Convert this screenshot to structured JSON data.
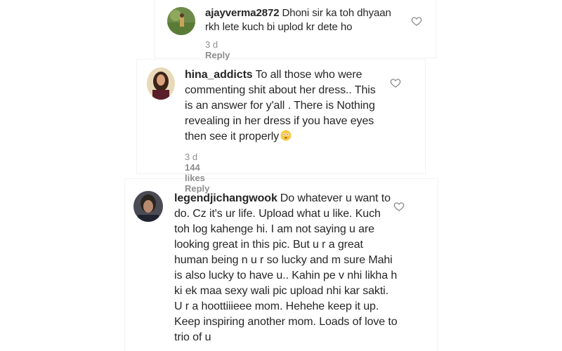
{
  "comments": [
    {
      "username": "ajayverma2872",
      "text": "Dhoni sir ka toh dhyaan rkh lete kuch bi uplod kr dete ho",
      "time": "3 d",
      "likes": "",
      "reply_label": "Reply"
    },
    {
      "username": "hina_addicts",
      "text": "To all those who were commenting shit about her dress.. This is an answer for y'all . There is Nothing revealing in her dress if you have eyes then see it properly",
      "emoji": "flushed-face",
      "time": "3 d",
      "likes": "144 likes",
      "reply_label": "Reply"
    },
    {
      "username": "legendjichangwook",
      "text": "Do whatever u want to do. Cz it's ur life. Upload what u like. Kuch toh log kahenge hi. I am not saying u are looking great in this pic. But u r a great human being n u r so lucky and m sure Mahi is also lucky to have u.. Kahin pe v nhi likha h ki ek maa sexy wali pic upload nhi kar sakti. U r a hoottiiieee mom. Hehehe keep it up. Keep inspiring another mom. Loads of love to trio of u",
      "time": "",
      "likes": "",
      "reply_label": ""
    }
  ],
  "icons": {
    "like": "heart-outline-icon"
  },
  "colors": {
    "text": "#262626",
    "meta": "#8e8e8e",
    "heart": "#8e8e8e",
    "emoji": "#f7c842"
  }
}
